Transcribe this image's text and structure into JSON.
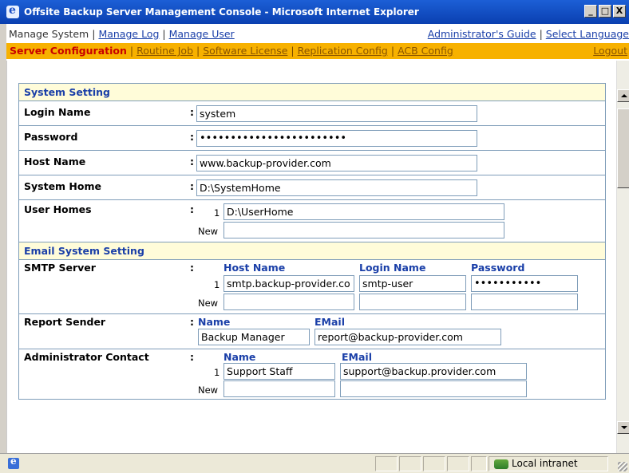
{
  "window": {
    "title": "Offsite Backup Server Management Console - Microsoft Internet Explorer",
    "minimize": "_",
    "maximize": "□",
    "close": "X"
  },
  "nav_top": {
    "current": "Manage System",
    "links": [
      "Manage Log",
      "Manage User"
    ],
    "right_links": [
      "Administrator's Guide",
      "Select Language"
    ],
    "separator": "|"
  },
  "nav_sub": {
    "current": "Server Configuration",
    "links": [
      "Routine Job",
      "Software License",
      "Replication Config",
      "ACB Config"
    ],
    "logout": "Logout",
    "separator": "|"
  },
  "system_setting": {
    "title": "System Setting",
    "login_name": {
      "label": "Login Name",
      "value": "system"
    },
    "password": {
      "label": "Password",
      "value": "••••••••••••••••••••••••"
    },
    "host_name": {
      "label": "Host Name",
      "value": "www.backup-provider.com"
    },
    "system_home": {
      "label": "System Home",
      "value": "D:\\SystemHome"
    },
    "user_homes": {
      "label": "User Homes",
      "index": "1",
      "value": "D:\\UserHome",
      "new_label": "New",
      "new_value": ""
    }
  },
  "email_setting": {
    "title": "Email System Setting",
    "smtp": {
      "label": "SMTP Server",
      "col_host": "Host Name",
      "col_login": "Login Name",
      "col_password": "Password",
      "index": "1",
      "host": "smtp.backup-provider.co",
      "login": "smtp-user",
      "password": "•••••••••••",
      "new_label": "New"
    },
    "report_sender": {
      "label": "Report Sender",
      "col_name": "Name",
      "col_email": "EMail",
      "name": "Backup Manager",
      "email": "report@backup-provider.com"
    },
    "admin_contact": {
      "label": "Administrator Contact",
      "col_name": "Name",
      "col_email": "EMail",
      "index": "1",
      "name": "Support Staff",
      "email": "support@backup.provider.com",
      "new_label": "New"
    }
  },
  "colon": ":",
  "statusbar": {
    "zone": "Local intranet"
  }
}
